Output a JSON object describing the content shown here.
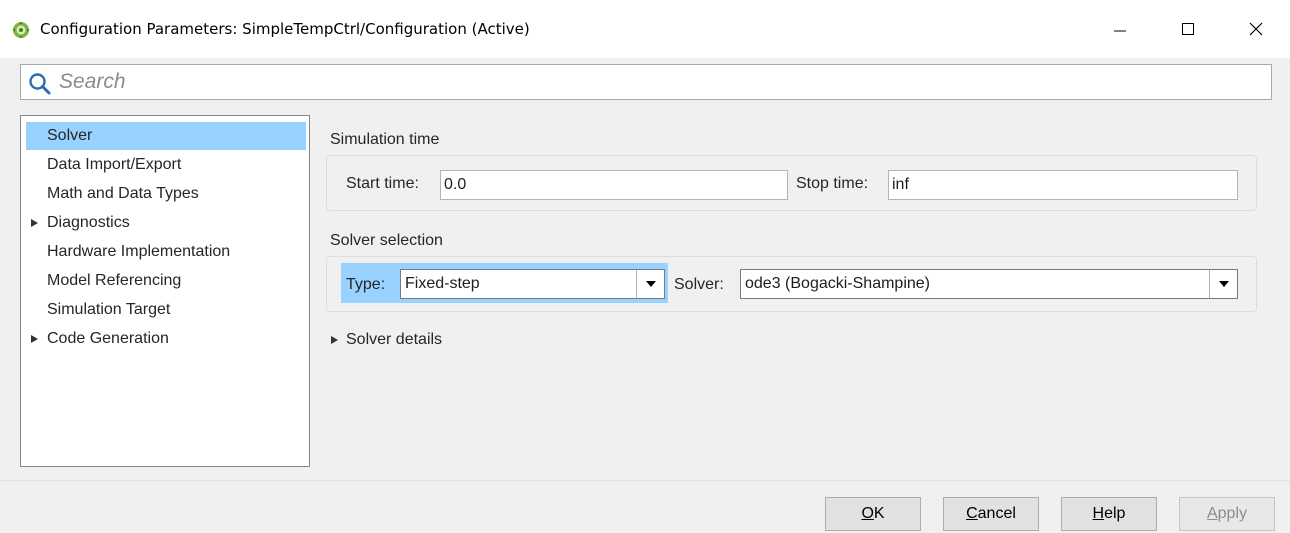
{
  "window": {
    "title": "Configuration Parameters: SimpleTempCtrl/Configuration (Active)",
    "icon": "simulink-config-icon",
    "controls": [
      "minimize",
      "maximize",
      "close"
    ]
  },
  "search": {
    "placeholder": "Search",
    "value": ""
  },
  "tree": {
    "items": [
      {
        "label": "Solver",
        "selected": true,
        "expandable": false
      },
      {
        "label": "Data Import/Export",
        "selected": false,
        "expandable": false
      },
      {
        "label": "Math and Data Types",
        "selected": false,
        "expandable": false
      },
      {
        "label": "Diagnostics",
        "selected": false,
        "expandable": true
      },
      {
        "label": "Hardware Implementation",
        "selected": false,
        "expandable": false
      },
      {
        "label": "Model Referencing",
        "selected": false,
        "expandable": false
      },
      {
        "label": "Simulation Target",
        "selected": false,
        "expandable": false
      },
      {
        "label": "Code Generation",
        "selected": false,
        "expandable": true
      }
    ]
  },
  "simulation_time": {
    "heading": "Simulation time",
    "start_label": "Start time:",
    "start_value": "0.0",
    "stop_label": "Stop time:",
    "stop_value": "inf"
  },
  "solver_selection": {
    "heading": "Solver selection",
    "type_label": "Type:",
    "type_value": "Fixed-step",
    "solver_label": "Solver:",
    "solver_value": "ode3 (Bogacki-Shampine)"
  },
  "solver_details": {
    "label": "Solver details"
  },
  "buttons": {
    "ok": {
      "before": "",
      "mnemonic": "O",
      "after": "K"
    },
    "cancel": {
      "before": "",
      "mnemonic": "C",
      "after": "ancel"
    },
    "help": {
      "before": "",
      "mnemonic": "H",
      "after": "elp"
    },
    "apply": {
      "before": "",
      "mnemonic": "A",
      "after": "pply",
      "disabled": true
    }
  },
  "colors": {
    "selection": "#99d1ff",
    "window_bg": "#f0f0f0"
  }
}
